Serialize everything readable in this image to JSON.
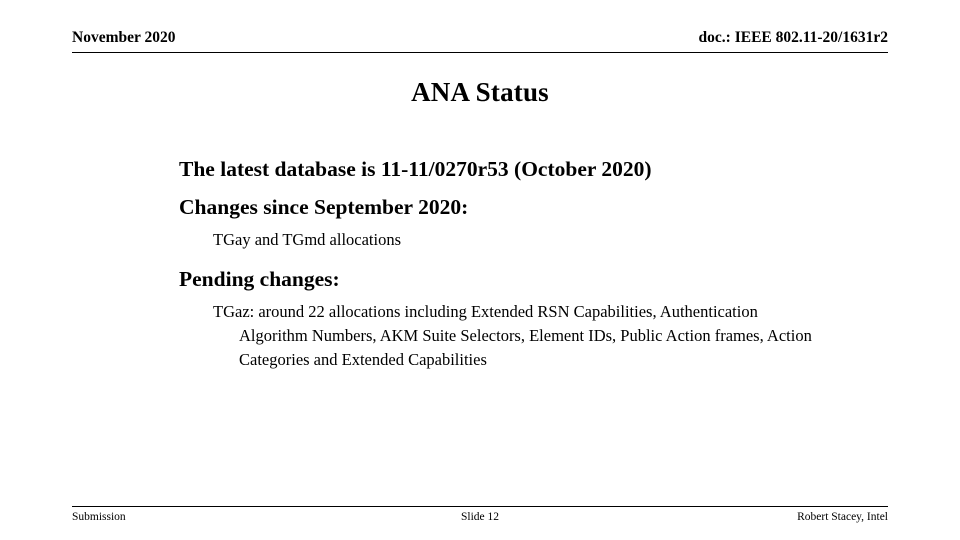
{
  "slide": {
    "header": {
      "date": "November 2020",
      "doc_reference": "doc.: IEEE 802.11-20/1631r2"
    },
    "title": "ANA Status",
    "body": {
      "line_latest_database": "The latest database is 11-11/0270r53 (October 2020)",
      "line_changes_since": "Changes since September 2020:",
      "line_tgay_tgmd": "TGay and TGmd allocations",
      "line_pending_changes": "Pending changes:",
      "line_tgaz": "TGaz: around 22 allocations including Extended RSN Capabilities, Authentication Algorithm Numbers, AKM Suite Selectors, Element IDs, Public Action frames, Action Categories and Extended Capabilities"
    },
    "footer": {
      "left": "Submission",
      "center": "Slide 12",
      "right": "Robert Stacey, Intel"
    }
  }
}
